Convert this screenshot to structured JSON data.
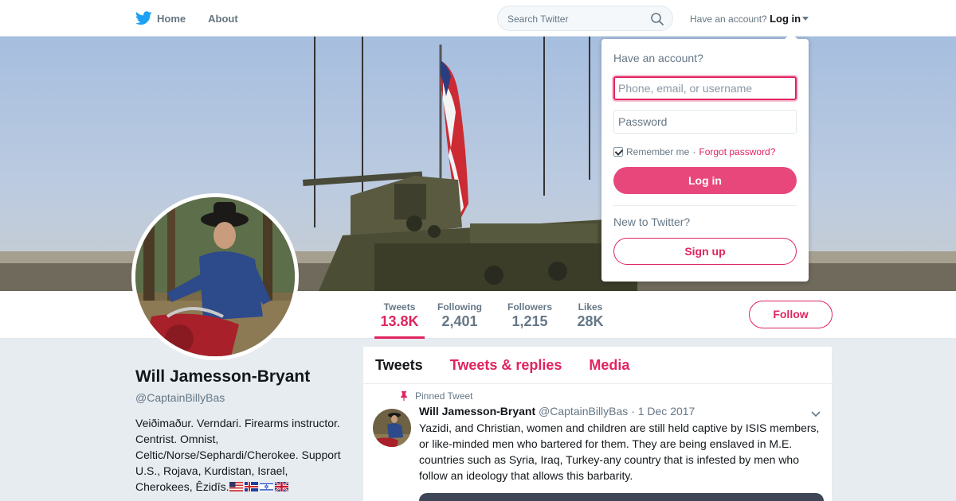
{
  "nav": {
    "home_label": "Home",
    "about_label": "About",
    "search_placeholder": "Search Twitter",
    "have_account": "Have an account?",
    "login_label": "Log in",
    "brand_icon": "twitter-bird-icon",
    "accent_color": "#1da1f2"
  },
  "login_dropdown": {
    "title": "Have an account?",
    "username_placeholder": "Phone, email, or username",
    "password_placeholder": "Password",
    "remember_label": "Remember me",
    "separator": "·",
    "forgot_label": "Forgot password?",
    "login_button": "Log in",
    "new_prompt": "New to Twitter?",
    "signup_button": "Sign up"
  },
  "profile": {
    "name": "Will Jamesson-Bryant",
    "handle": "@CaptainBillyBas",
    "bio": "Veiðimaður. Verndari. Firearms instructor. Centrist. Omnist, Celtic/Norse/Sephardi/Cherokee. Support U.S., Rojava, Kurdistan, Israel, Cherokees, Êzidîs.",
    "bio_flags": [
      "us-flag-icon",
      "iceland-flag-icon",
      "israel-flag-icon",
      "uk-flag-icon"
    ],
    "follow_button": "Follow",
    "accent_color": "#e0245e"
  },
  "stats": [
    {
      "label": "Tweets",
      "value": "13.8K",
      "active": true
    },
    {
      "label": "Following",
      "value": "2,401",
      "active": false
    },
    {
      "label": "Followers",
      "value": "1,215",
      "active": false
    },
    {
      "label": "Likes",
      "value": "28K",
      "active": false
    }
  ],
  "timeline": {
    "tabs": [
      {
        "label": "Tweets",
        "active": true
      },
      {
        "label": "Tweets & replies",
        "active": false
      },
      {
        "label": "Media",
        "active": false
      }
    ],
    "pinned_tweet": {
      "pinned_label": "Pinned Tweet",
      "author_name": "Will Jamesson-Bryant",
      "author_handle": "@CaptainBillyBas",
      "date": "· 1 Dec 2017",
      "text": "Yazidi, and Christian, women and children are still held captive by ISIS members, or like-minded men who bartered for them. They are being enslaved in M.E. countries such as Syria, Iraq, Turkey-any country that is infested by men who follow an ideology that allows this barbarity."
    }
  }
}
